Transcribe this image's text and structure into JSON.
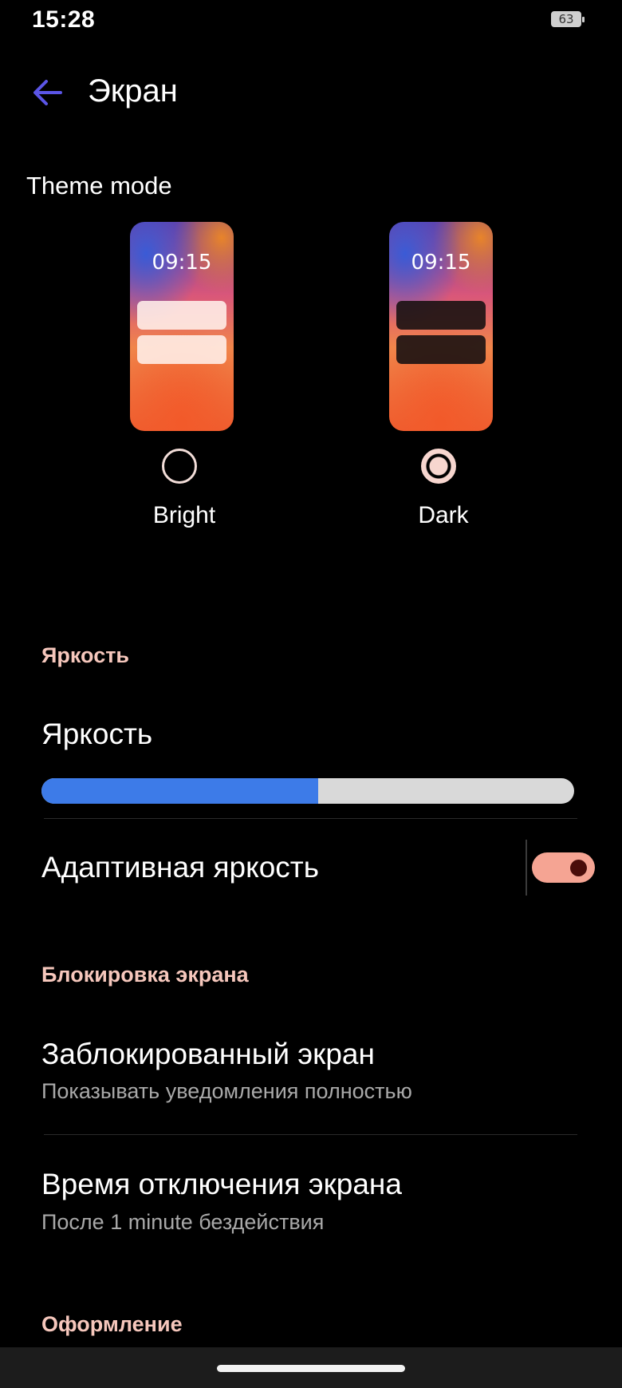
{
  "status_bar": {
    "time": "15:28",
    "battery": "63"
  },
  "header": {
    "title": "Экран",
    "back_icon": "arrow-left-icon"
  },
  "theme_mode": {
    "title": "Theme mode",
    "options": [
      {
        "label": "Bright",
        "preview_time": "09:15",
        "selected": false
      },
      {
        "label": "Dark",
        "preview_time": "09:15",
        "selected": true
      }
    ]
  },
  "brightness_section": {
    "header": "Яркость",
    "brightness": {
      "title": "Яркость",
      "level": 0.52
    },
    "adaptive": {
      "title": "Адаптивная яркость",
      "enabled": true
    }
  },
  "lock_section": {
    "header": "Блокировка экрана",
    "locked_screen": {
      "title": "Заблокированный экран",
      "subtitle": "Показывать уведомления полностью"
    },
    "screen_timeout": {
      "title": "Время отключения экрана",
      "subtitle": "После 1 minute бездействия"
    }
  },
  "design_section": {
    "header": "Оформление"
  },
  "colors": {
    "accent_blue": "#3d7be8",
    "accent_pink": "#f6c7bc",
    "toggle_on": "#f5a493",
    "back_arrow": "#5b55e6"
  }
}
